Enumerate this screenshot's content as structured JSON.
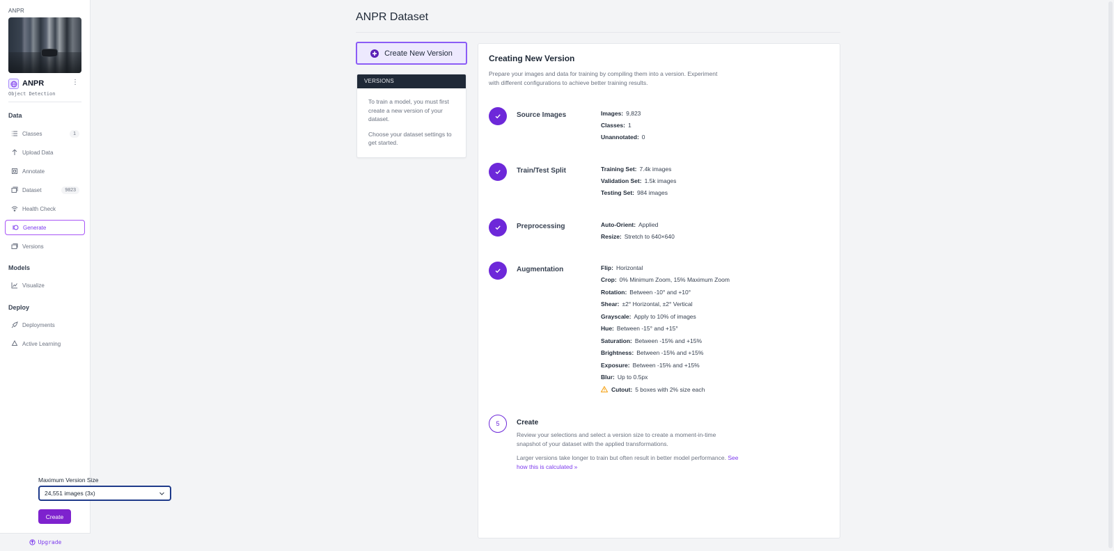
{
  "sidebar": {
    "project_label": "ANPR",
    "project_name": "ANPR",
    "project_type": "Object Detection",
    "menu_icon": "vertical-ellipsis-icon",
    "sections": {
      "data": "Data",
      "models": "Models",
      "deploy": "Deploy"
    },
    "items": [
      {
        "label": "Classes",
        "icon": "list-icon",
        "badge": "1"
      },
      {
        "label": "Upload Data",
        "icon": "arrow-up-icon",
        "badge": ""
      },
      {
        "label": "Annotate",
        "icon": "annotate-icon",
        "badge": ""
      },
      {
        "label": "Dataset",
        "icon": "images-icon",
        "badge": "9823"
      },
      {
        "label": "Health Check",
        "icon": "health-icon",
        "badge": ""
      },
      {
        "label": "Generate",
        "icon": "generate-icon",
        "badge": "",
        "active": true
      },
      {
        "label": "Versions",
        "icon": "versions-icon",
        "badge": ""
      },
      {
        "label": "Visualize",
        "icon": "chart-icon",
        "badge": ""
      },
      {
        "label": "Deployments",
        "icon": "rocket-icon",
        "badge": ""
      },
      {
        "label": "Active Learning",
        "icon": "recycle-icon",
        "badge": ""
      }
    ],
    "upgrade_label": "Upgrade"
  },
  "header": {
    "title": "ANPR Dataset"
  },
  "left_panel": {
    "create_button": "Create New Version",
    "versions_header": "VERSIONS",
    "versions_text_1": "To train a model, you must first create a new version of your dataset.",
    "versions_text_2": "Choose your dataset settings to get started."
  },
  "main": {
    "title": "Creating New Version",
    "description": "Prepare your images and data for training by compiling them into a version. Experiment with different configurations to achieve better training results.",
    "steps": [
      {
        "name": "Source Images",
        "details": [
          {
            "k": "Images:",
            "v": "9,823"
          },
          {
            "k": "Classes:",
            "v": "1"
          },
          {
            "k": "Unannotated:",
            "v": "0"
          }
        ]
      },
      {
        "name": "Train/Test Split",
        "details": [
          {
            "k": "Training Set:",
            "v": "7.4k images"
          },
          {
            "k": "Validation Set:",
            "v": "1.5k images"
          },
          {
            "k": "Testing Set:",
            "v": "984 images"
          }
        ]
      },
      {
        "name": "Preprocessing",
        "details": [
          {
            "k": "Auto-Orient:",
            "v": "Applied"
          },
          {
            "k": "Resize:",
            "v": "Stretch to 640×640"
          }
        ]
      },
      {
        "name": "Augmentation",
        "details": [
          {
            "k": "Flip:",
            "v": "Horizontal"
          },
          {
            "k": "Crop:",
            "v": "0% Minimum Zoom, 15% Maximum Zoom"
          },
          {
            "k": "Rotation:",
            "v": "Between -10° and +10°"
          },
          {
            "k": "Shear:",
            "v": "±2° Horizontal, ±2° Vertical"
          },
          {
            "k": "Grayscale:",
            "v": "Apply to 10% of images"
          },
          {
            "k": "Hue:",
            "v": "Between -15° and +15°"
          },
          {
            "k": "Saturation:",
            "v": "Between -15% and +15%"
          },
          {
            "k": "Brightness:",
            "v": "Between -15% and +15%"
          },
          {
            "k": "Exposure:",
            "v": "Between -15% and +15%"
          },
          {
            "k": "Blur:",
            "v": "Up to 0.5px"
          },
          {
            "k": "Cutout:",
            "v": "5 boxes with 2% size each",
            "icon": "warning-icon"
          }
        ]
      }
    ],
    "create_step": {
      "number": "5",
      "name": "Create",
      "desc_1": "Review your selections and select a version size to create a moment-in-time snapshot of your dataset with the applied transformations.",
      "desc_2": "Larger versions take longer to train but often result in better model performance.",
      "link": "See how this is calculated »",
      "size_label": "Maximum Version Size",
      "size_value": "24,551 images (3x)",
      "create_button": "Create"
    }
  },
  "colors": {
    "accent": "#6d28d9",
    "accent_light": "#ede9fe",
    "button": "#7e22ce",
    "warning": "#f59e0b"
  }
}
